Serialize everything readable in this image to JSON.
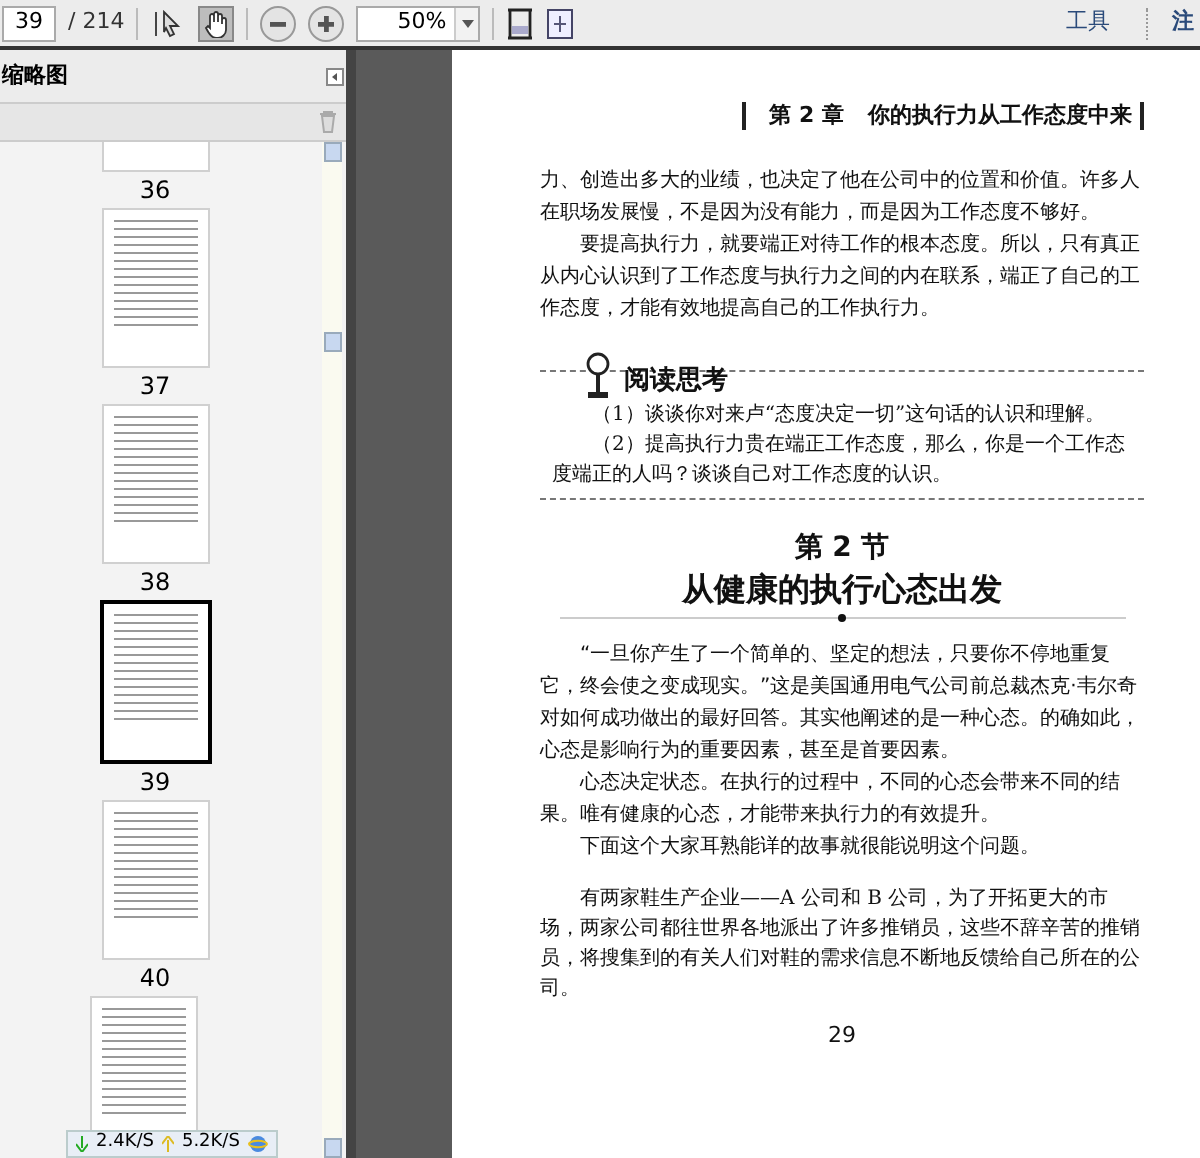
{
  "toolbar": {
    "page_field": {
      "value": "39"
    },
    "page_total": "/ 214",
    "tools": [
      {
        "kind": "select",
        "selected": false
      },
      {
        "kind": "hand",
        "selected": true
      }
    ],
    "zoom_field": {
      "value": "50%"
    },
    "menu": [
      "工具",
      "注"
    ]
  },
  "sidebar": {
    "title": "缩略图",
    "thumbnails": [
      {
        "label": "36",
        "selected": false
      },
      {
        "label": "37",
        "selected": false
      },
      {
        "label": "38",
        "selected": false
      },
      {
        "label": "39",
        "selected": true
      },
      {
        "label": "40",
        "selected": false
      }
    ]
  },
  "status_bar": {
    "download": "2.4K/S",
    "upload": "5.2K/S"
  },
  "page": {
    "chapter": "第 2 章",
    "chapter_title": "你的执行力从工作态度中来",
    "paragraphs_top": [
      {
        "text": "力、创造出多大的业绩，也决定了他在公司中的位置和价值。许多人在职场发展慢，不是因为没有能力，而是因为工作态度不够好。",
        "indent": false
      },
      {
        "text": "要提高执行力，就要端正对待工作的根本态度。所以，只有真正从内心认识到了工作态度与执行力之间的内在联系，端正了自己的工作态度，才能有效地提高自己的工作执行力。",
        "indent": true
      }
    ],
    "reading_box": {
      "title": "阅读思考",
      "items": [
        "（1）谈谈你对来卢“态度决定一切”这句话的认识和理解。",
        "（2）提高执行力贵在端正工作态度，那么，你是一个工作态度端正的人吗？谈谈自己对工作态度的认识。"
      ]
    },
    "section_number": "第 2 节",
    "section_title": "从健康的执行心态出发",
    "paragraphs": [
      {
        "text": "“一旦你产生了一个简单的、坚定的想法，只要你不停地重复它，终会使之变成现实。”这是美国通用电气公司前总裁杰克·韦尔奇对如何成功做出的最好回答。其实他阐述的是一种心态。的确如此，心态是影响行为的重要因素，甚至是首要因素。",
        "indent": true
      },
      {
        "text": "心态决定状态。在执行的过程中，不同的心态会带来不同的结果。唯有健康的心态，才能带来执行力的有效提升。",
        "indent": true
      },
      {
        "text": "下面这个大家耳熟能详的故事就很能说明这个问题。",
        "indent": true
      }
    ],
    "story": "有两家鞋生产企业——A 公司和 B 公司，为了开拓更大的市场，两家公司都往世界各地派出了许多推销员，这些不辞辛苦的推销员，将搜集到的有关人们对鞋的需求信息不断地反馈给自己所在的公司。",
    "page_number": "29"
  }
}
